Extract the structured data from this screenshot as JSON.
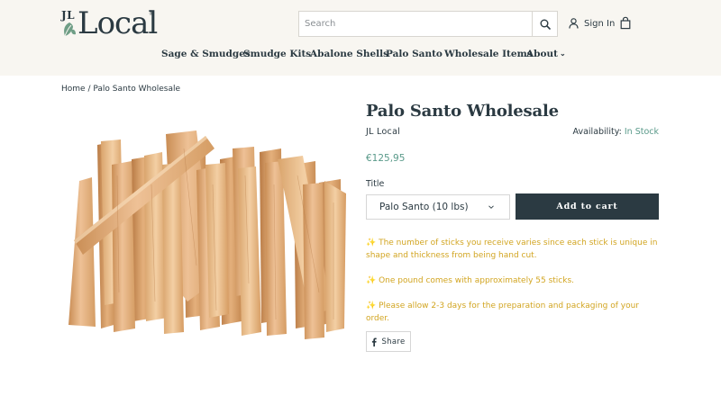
{
  "header": {
    "logo_prefix": "JL",
    "logo_word": "Local",
    "logo_mark": "®",
    "search": {
      "placeholder": "Search",
      "value": ""
    },
    "signin_label": "Sign In",
    "icons": {
      "search": "search-icon",
      "user": "user-icon",
      "cart": "shopping-bag-icon",
      "leaf": "leaf-icon"
    }
  },
  "nav": {
    "items": [
      {
        "label": "Sage & Smudges"
      },
      {
        "label": "Smudge Kits"
      },
      {
        "label": "Abalone Shells"
      },
      {
        "label": "Palo Santo"
      },
      {
        "label": "Wholesale Items"
      },
      {
        "label": "About"
      }
    ],
    "about_chevron": "⌄"
  },
  "breadcrumb": {
    "home": "Home",
    "separator": "/",
    "current": "Palo Santo Wholesale"
  },
  "product": {
    "title": "Palo Santo Wholesale",
    "vendor": "JL Local",
    "availability_label": "Availability:",
    "availability_value": "In Stock",
    "price": "€125,95",
    "option_label": "Title",
    "option_selected": "Palo Santo (10 lbs)",
    "add_to_cart": "Add to cart",
    "description": [
      "✨ The number of sticks you receive varies since each stick is unique in shape and thickness from being hand cut.",
      "✨ One pound comes with approximately 55 sticks.",
      "✨ Please allow 2-3 days for the preparation and packaging of your order."
    ],
    "share_label": "Share"
  },
  "colors": {
    "brand_dark": "#2b3a42",
    "header_bg": "#f8f6f1",
    "accent_green": "#5a9a8a",
    "description_gold": "#d2a521",
    "leaf_green": "#6f9e86"
  }
}
